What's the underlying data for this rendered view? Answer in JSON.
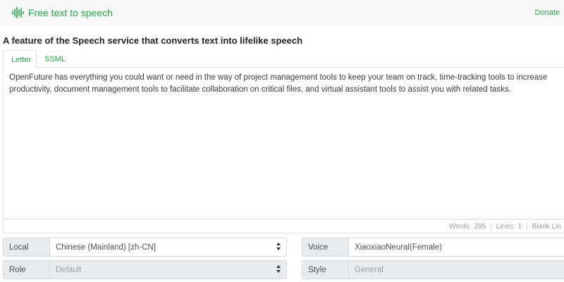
{
  "app": {
    "title": "Free text to speech",
    "donate_label": "Donate",
    "accent_color": "#28a745",
    "logo_icon": "sound-wave-icon"
  },
  "heading": "A feature of the Speech service that converts text into lifelike speech",
  "tabs": [
    {
      "label": "Letter",
      "active": true
    },
    {
      "label": "SSML",
      "active": false
    }
  ],
  "editor": {
    "text": "OpenFuture has everything you could want or need in the way of project management tools to keep your team on track, time-tracking tools to increase productivity, document management tools to facilitate collaboration on critical files, and virtual assistant tools to assist you with related tasks."
  },
  "status": {
    "words_label": "Words:",
    "words_value": "295",
    "lines_label": "Lines:",
    "lines_value": "1",
    "blank_label": "Blank Lin"
  },
  "fields": {
    "local": {
      "label": "Local",
      "value": "Chinese (Mainland) [zh-CN]"
    },
    "voice": {
      "label": "Voice",
      "value": "XiaoxiaoNeural(Female)"
    },
    "role": {
      "label": "Role",
      "value": "Default"
    },
    "style": {
      "label": "Style",
      "value": "General"
    }
  }
}
